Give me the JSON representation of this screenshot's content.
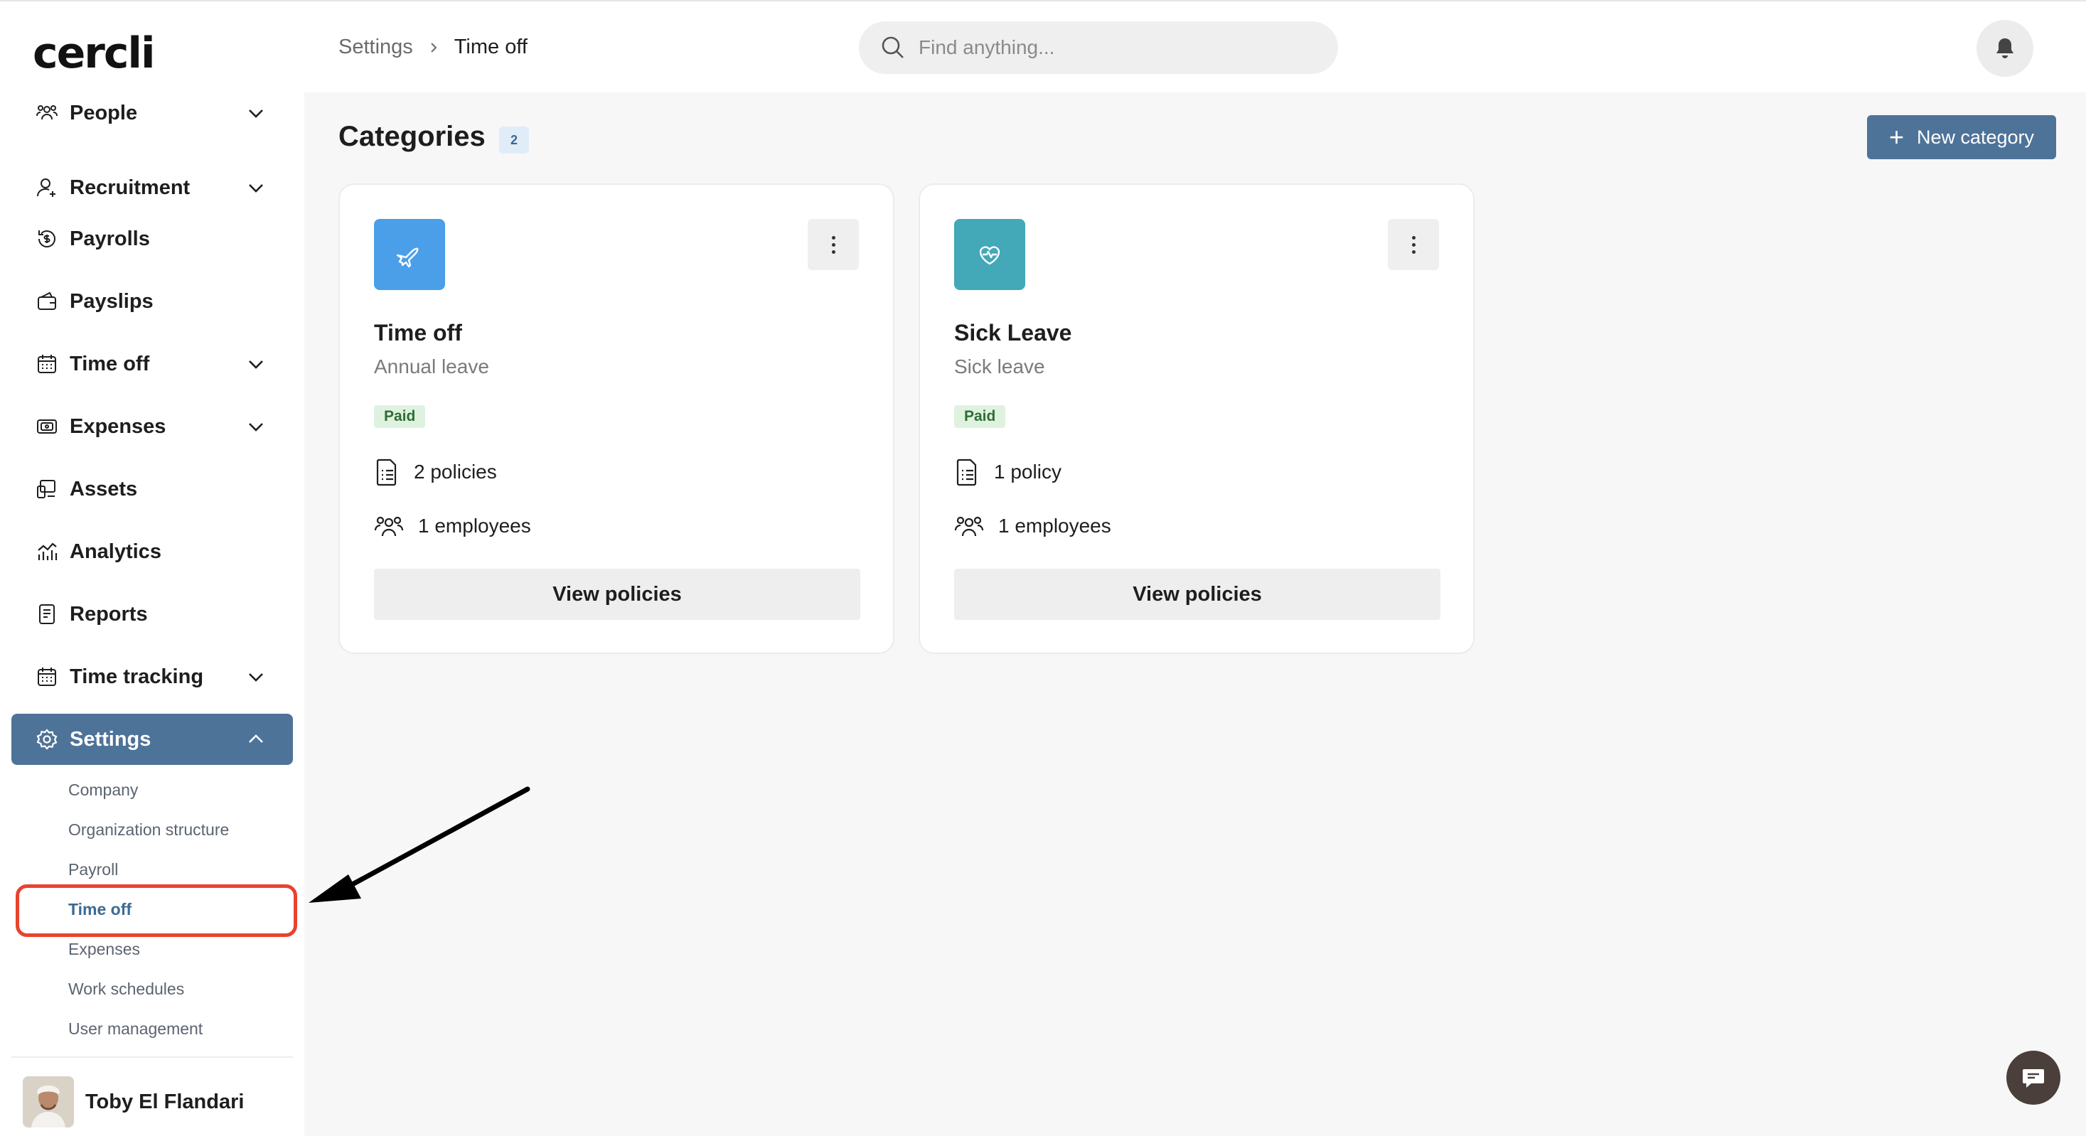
{
  "app": {
    "logo": "cercli"
  },
  "sidebar": {
    "items": [
      {
        "label": "People",
        "icon": "people-icon",
        "expandable": true
      },
      {
        "label": "Recruitment",
        "icon": "user-plus-icon",
        "expandable": true
      },
      {
        "label": "Payrolls",
        "icon": "payroll-icon",
        "expandable": false
      },
      {
        "label": "Payslips",
        "icon": "wallet-icon",
        "expandable": false
      },
      {
        "label": "Time off",
        "icon": "calendar-icon",
        "expandable": true
      },
      {
        "label": "Expenses",
        "icon": "receipt-icon",
        "expandable": true
      },
      {
        "label": "Assets",
        "icon": "devices-icon",
        "expandable": false
      },
      {
        "label": "Analytics",
        "icon": "analytics-icon",
        "expandable": false
      },
      {
        "label": "Reports",
        "icon": "report-icon",
        "expandable": false
      },
      {
        "label": "Time tracking",
        "icon": "calendar-icon",
        "expandable": true
      },
      {
        "label": "Settings",
        "icon": "gear-icon",
        "expandable": true,
        "active": true
      }
    ],
    "settings_sub": [
      "Company",
      "Organization structure",
      "Payroll",
      "Time off",
      "Expenses",
      "Work schedules",
      "User management"
    ],
    "settings_sub_active": "Time off",
    "user": {
      "name": "Toby El Flandari"
    }
  },
  "topbar": {
    "breadcrumb": {
      "parent": "Settings",
      "current": "Time off"
    },
    "search_placeholder": "Find anything..."
  },
  "main": {
    "title": "Categories",
    "count": "2",
    "new_button": "New category",
    "cards": [
      {
        "title": "Time off",
        "subtitle": "Annual leave",
        "badge": "Paid",
        "policies": "2 policies",
        "employees": "1 employees",
        "button": "View policies",
        "icon": "airplane-icon",
        "color": "#4a9fe8"
      },
      {
        "title": "Sick Leave",
        "subtitle": "Sick leave",
        "badge": "Paid",
        "policies": "1 policy",
        "employees": "1 employees",
        "button": "View policies",
        "icon": "heart-icon",
        "color": "#43a8b8"
      }
    ]
  },
  "colors": {
    "accent": "#4e7399",
    "highlight": "#e8432d",
    "paid_bg": "#dff2e0",
    "paid_text": "#2f6e35"
  }
}
